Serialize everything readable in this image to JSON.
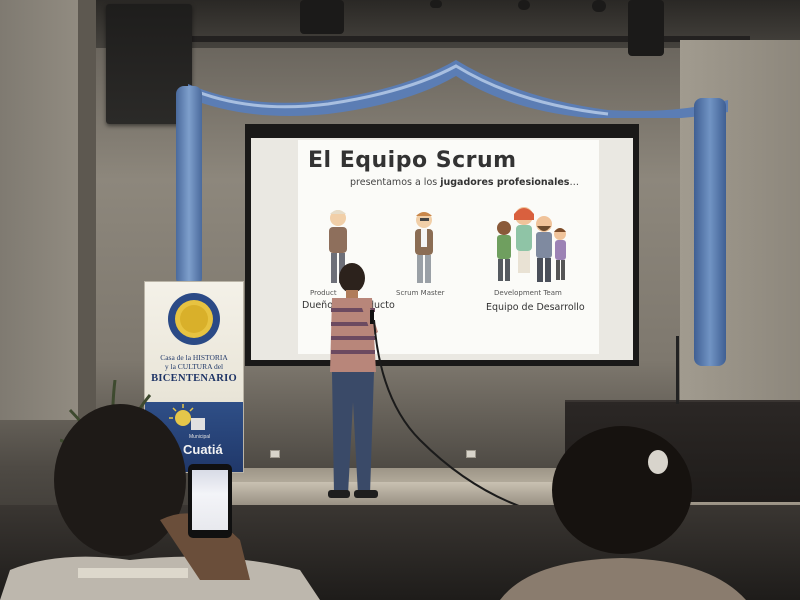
{
  "slide": {
    "title": "El Equipo Scrum",
    "subtitle_prefix": "presentamos a los ",
    "subtitle_bold": "jugadores profesionales",
    "subtitle_suffix": "…",
    "roles": [
      {
        "caption_en": "Product",
        "caption_es": "Dueño",
        "caption_es_right": "ducto"
      },
      {
        "caption_en": "Scrum Master"
      },
      {
        "caption_en": "Development Team",
        "caption_es": "Equipo de Desarrollo"
      }
    ]
  },
  "banner": {
    "line1": "Casa de la HISTORIA",
    "line2": "y la CULTURA del",
    "line3": "BICENTENARIO",
    "muni": "Municipal",
    "city": "Cuatiá"
  },
  "colors": {
    "curtain_blue": "#5b7db4",
    "wall": "#8d877c",
    "screen": "#fbfbf8"
  }
}
